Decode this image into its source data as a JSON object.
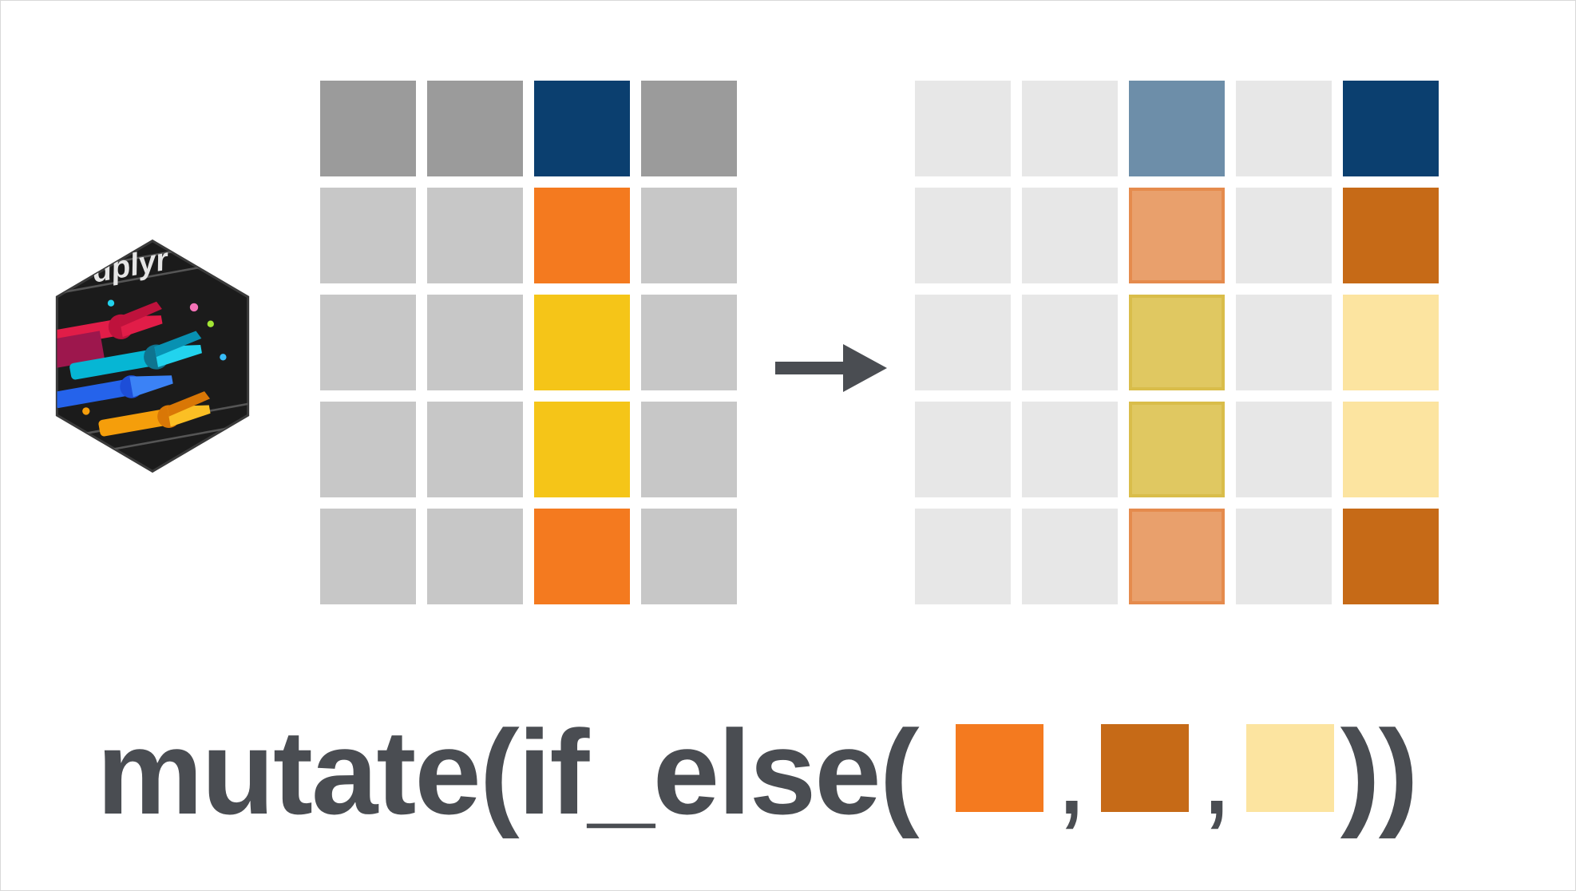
{
  "colors": {
    "header_gray": "#9b9b9b",
    "cell_gray": "#c7c7c7",
    "light_gray": "#e7e7e7",
    "navy": "#0b3f6f",
    "navy_faded": "#6d8ea9",
    "orange": "#f47a1f",
    "orange_faded": "#e9a06c",
    "orange_faded_border": "#e58b4d",
    "yellow": "#f5c518",
    "yellow_faded": "#e0c861",
    "yellow_faded_border": "#d9bd4a",
    "brown": "#c66a17",
    "pale_yellow": "#fce4a0",
    "caption_text": "#4a4d52",
    "arrow": "#4a4d52"
  },
  "left_grid": [
    [
      "header_gray",
      "header_gray",
      "navy",
      "header_gray"
    ],
    [
      "cell_gray",
      "cell_gray",
      "orange",
      "cell_gray"
    ],
    [
      "cell_gray",
      "cell_gray",
      "yellow",
      "cell_gray"
    ],
    [
      "cell_gray",
      "cell_gray",
      "yellow",
      "cell_gray"
    ],
    [
      "cell_gray",
      "cell_gray",
      "orange",
      "cell_gray"
    ]
  ],
  "right_grid": [
    [
      "light_gray",
      "light_gray",
      "navy_faded",
      "light_gray",
      "navy"
    ],
    [
      "light_gray",
      "light_gray",
      "orange_faded",
      "light_gray",
      "brown"
    ],
    [
      "light_gray",
      "light_gray",
      "yellow_faded",
      "light_gray",
      "pale_yellow"
    ],
    [
      "light_gray",
      "light_gray",
      "yellow_faded",
      "light_gray",
      "pale_yellow"
    ],
    [
      "light_gray",
      "light_gray",
      "orange_faded",
      "light_gray",
      "brown"
    ]
  ],
  "caption": {
    "p1": "mutate(if_else(",
    "p2": ",",
    "p3": ",",
    "p4": "))",
    "sq1": "orange",
    "sq2": "brown",
    "sq3": "pale_yellow"
  },
  "logo_text": "dplyr"
}
